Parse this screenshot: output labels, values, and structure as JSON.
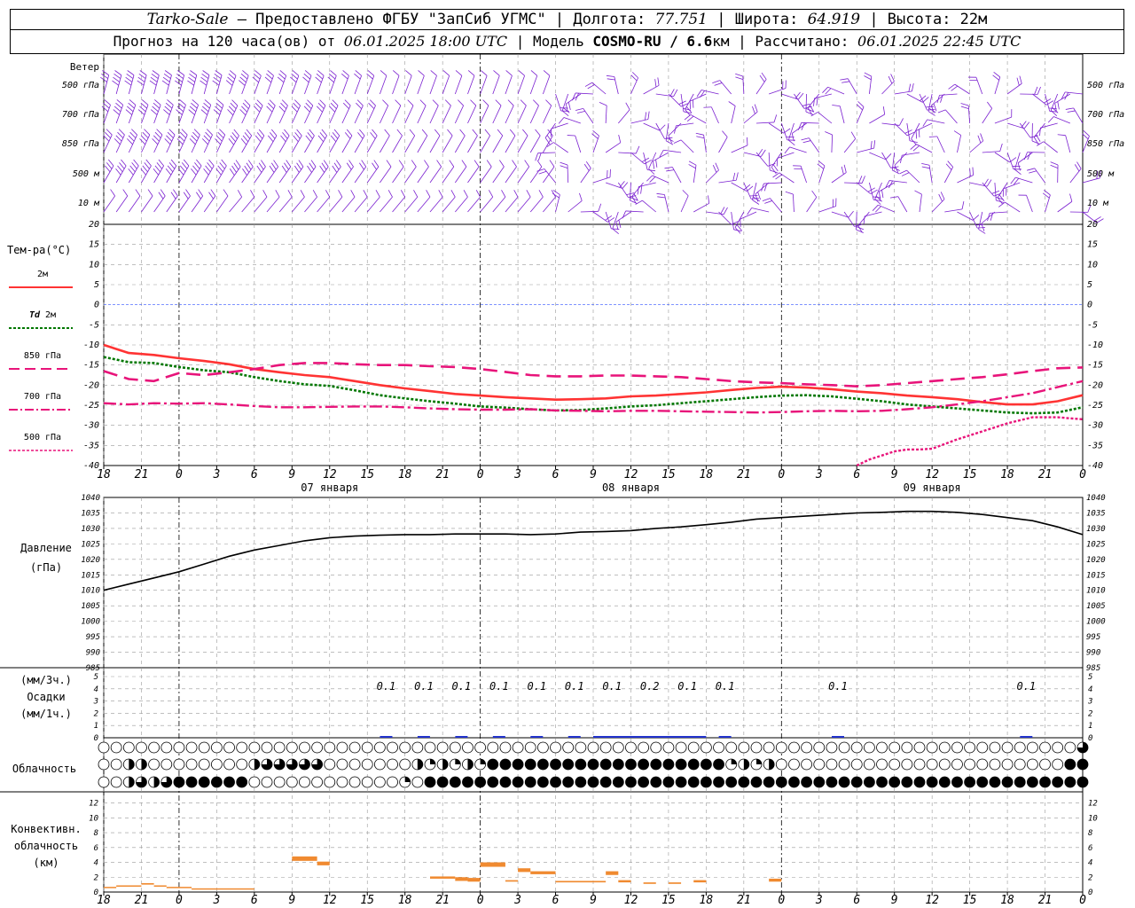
{
  "header": {
    "station": "Tarko-Sale",
    "provider": " – Предоставлено ФГБУ \"ЗапСиб УГМС\" | Долгота: ",
    "lon": "77.751",
    "lat_label": " | Широта: ",
    "lat": "64.919",
    "alt_label": " | Высота: 22м",
    "forecast_label": "Прогноз на 120 часа(ов) от ",
    "forecast_time": "06.01.2025 18:00 UTC",
    "model_label": " | Модель ",
    "model": "COSMO-RU / 6.6",
    "model_res_unit": "км",
    "calc_label": " | Рассчитано: ",
    "calc_time": "06.01.2025 22:45 UTC"
  },
  "wind_panel": {
    "title": "Ветер",
    "levels": [
      "500 гПа",
      "700 гПа",
      "850 гПа",
      "500 м",
      "10  м"
    ]
  },
  "colors": {
    "t2m": "#ff3333",
    "td2m": "#007700",
    "t850": "#e8147a",
    "t700": "#e8147a",
    "t500": "#e8147a",
    "wind": "#7a1fd0",
    "zero_line": "#3355ff",
    "precip": "#2233cc",
    "convective": "#f08a30"
  },
  "time_axis": {
    "tick_labels": [
      "18",
      "21",
      "0",
      "3",
      "6",
      "9",
      "12",
      "15",
      "18",
      "21",
      "0",
      "3",
      "6",
      "9",
      "12",
      "15",
      "18",
      "21",
      "0",
      "3",
      "6",
      "9",
      "12",
      "15",
      "18",
      "21",
      "0"
    ],
    "day_labels": [
      "07 января",
      "08 января",
      "09 января"
    ]
  },
  "temp_panel": {
    "title": "Тем-ра(°С)",
    "legend": [
      {
        "label": "2м",
        "italic_prefix": ""
      },
      {
        "label": "2м",
        "italic_prefix": "Td"
      },
      {
        "label": "850 гПа",
        "italic_prefix": ""
      },
      {
        "label": "700 гПа",
        "italic_prefix": ""
      },
      {
        "label": "500 гПа",
        "italic_prefix": ""
      }
    ],
    "y_ticks": [
      "20",
      "15",
      "10",
      "5",
      "0",
      "-5",
      "-10",
      "-15",
      "-20",
      "-25",
      "-30",
      "-35",
      "-40"
    ]
  },
  "pressure_panel": {
    "title_line1": "Давление",
    "title_line2": "(гПа)",
    "y_ticks": [
      "1040",
      "1035",
      "1030",
      "1025",
      "1020",
      "1015",
      "1010",
      "1005",
      "1000",
      "995",
      "990",
      "985"
    ]
  },
  "precip_panel": {
    "title_line1": "(мм/3ч.)",
    "title_line2": "Осадки",
    "title_line3": "(мм/1ч.)",
    "y_ticks": [
      "5",
      "4",
      "3",
      "2",
      "1",
      "0"
    ],
    "amount_labels": [
      {
        "t": 24,
        "text": "0.1"
      },
      {
        "t": 27,
        "text": "0.1"
      },
      {
        "t": 30,
        "text": "0.1"
      },
      {
        "t": 33,
        "text": "0.1"
      },
      {
        "t": 36,
        "text": "0.1"
      },
      {
        "t": 39,
        "text": "0.1"
      },
      {
        "t": 42,
        "text": "0.1"
      },
      {
        "t": 45,
        "text": "0.2"
      },
      {
        "t": 48,
        "text": "0.1"
      },
      {
        "t": 51,
        "text": "0.1"
      },
      {
        "t": 60,
        "text": "0.1"
      },
      {
        "t": 75,
        "text": "0.1"
      }
    ]
  },
  "cloud_panel": {
    "title": "Облачность"
  },
  "conv_panel": {
    "title_line1": "Конвективн.",
    "title_line2": "облачность",
    "title_line3": "(км)",
    "y_ticks": [
      "12",
      "10",
      "8",
      "6",
      "4",
      "2",
      "0"
    ]
  },
  "chart_data": [
    {
      "type": "line",
      "title": "Тем-ра(°С)",
      "x_unit": "hours since 06.01.2025 18:00 UTC",
      "ylim": [
        -40,
        20
      ],
      "series": [
        {
          "name": "2м",
          "x": [
            0,
            2,
            4,
            6,
            8,
            10,
            12,
            14,
            16,
            18,
            20,
            22,
            24,
            26,
            28,
            30,
            32,
            34,
            36,
            38,
            40,
            42,
            44,
            46,
            48,
            50,
            52,
            54,
            56,
            58,
            60,
            62,
            64,
            66,
            68,
            70,
            72,
            74,
            76,
            78
          ],
          "values": [
            -10,
            -12,
            -12.5,
            -13.3,
            -14,
            -14.8,
            -16,
            -16.8,
            -17.5,
            -18,
            -19,
            -20,
            -20.8,
            -21.5,
            -22.2,
            -22.6,
            -23,
            -23.3,
            -23.6,
            -23.5,
            -23.3,
            -22.8,
            -22.6,
            -22.2,
            -21.8,
            -21.2,
            -20.7,
            -20.4,
            -20.6,
            -21,
            -21.6,
            -22,
            -22.6,
            -23,
            -23.5,
            -24.2,
            -24.8,
            -24.8,
            -24,
            -22.5
          ]
        },
        {
          "name": "Td 2м",
          "x": [
            0,
            2,
            4,
            6,
            8,
            10,
            12,
            14,
            16,
            18,
            20,
            22,
            24,
            26,
            28,
            30,
            32,
            34,
            36,
            38,
            40,
            42,
            44,
            46,
            48,
            50,
            52,
            54,
            56,
            58,
            60,
            62,
            64,
            66,
            68,
            70,
            72,
            74,
            76,
            78
          ],
          "values": [
            -13,
            -14.3,
            -14.5,
            -15.5,
            -16.3,
            -16.8,
            -18,
            -19,
            -19.8,
            -20.2,
            -21.3,
            -22.5,
            -23.3,
            -24,
            -24.6,
            -25.3,
            -25.6,
            -26,
            -26.3,
            -26.2,
            -25.8,
            -25.3,
            -25,
            -24.5,
            -24,
            -23.5,
            -23,
            -22.6,
            -22.5,
            -22.8,
            -23.4,
            -24,
            -24.8,
            -25.3,
            -25.8,
            -26.3,
            -26.8,
            -27,
            -26.8,
            -25.5
          ]
        },
        {
          "name": "850 гПа",
          "x": [
            0,
            2,
            4,
            6,
            8,
            10,
            12,
            14,
            16,
            18,
            20,
            22,
            24,
            26,
            28,
            30,
            32,
            34,
            36,
            38,
            40,
            42,
            44,
            46,
            48,
            50,
            52,
            54,
            56,
            58,
            60,
            62,
            64,
            66,
            68,
            70,
            72,
            74,
            76,
            78
          ],
          "values": [
            -16.5,
            -18.5,
            -19,
            -17,
            -17.5,
            -16.8,
            -16,
            -15,
            -14.5,
            -14.5,
            -14.8,
            -15,
            -15,
            -15.3,
            -15.5,
            -16,
            -16.7,
            -17.5,
            -17.8,
            -17.8,
            -17.6,
            -17.6,
            -17.8,
            -18,
            -18.5,
            -19,
            -19.3,
            -19.5,
            -19.8,
            -20,
            -20.3,
            -20,
            -19.5,
            -19,
            -18.5,
            -18,
            -17.3,
            -16.5,
            -15.8,
            -15.6
          ]
        },
        {
          "name": "700 гПа",
          "x": [
            0,
            2,
            4,
            6,
            8,
            10,
            12,
            14,
            16,
            18,
            20,
            22,
            24,
            26,
            28,
            30,
            32,
            34,
            36,
            38,
            40,
            42,
            44,
            46,
            48,
            50,
            52,
            54,
            56,
            58,
            60,
            62,
            64,
            66,
            68,
            70,
            72,
            74,
            76,
            78
          ],
          "values": [
            -24.5,
            -24.8,
            -24.5,
            -24.6,
            -24.5,
            -24.8,
            -25.2,
            -25.5,
            -25.5,
            -25.4,
            -25.3,
            -25.3,
            -25.5,
            -25.8,
            -26,
            -26.1,
            -26.1,
            -26,
            -26.3,
            -26.4,
            -26.5,
            -26.4,
            -26.4,
            -26.5,
            -26.6,
            -26.7,
            -26.8,
            -26.7,
            -26.5,
            -26.4,
            -26.5,
            -26.4,
            -26,
            -25.5,
            -24.8,
            -24,
            -23,
            -22,
            -20.5,
            -19
          ]
        },
        {
          "name": "500 гПа",
          "x": [
            60,
            61,
            62,
            63,
            64,
            65,
            66,
            68,
            70,
            72,
            74,
            76,
            78
          ],
          "values": [
            -40,
            -38.5,
            -37.5,
            -36.5,
            -36,
            -36,
            -35.8,
            -33.5,
            -31.5,
            -29.5,
            -28,
            -28,
            -28.5
          ]
        }
      ]
    },
    {
      "type": "line",
      "title": "Давление",
      "ylabel": "(гПа)",
      "ylim": [
        985,
        1040
      ],
      "series": [
        {
          "name": "Давление",
          "x": [
            0,
            2,
            4,
            6,
            8,
            10,
            12,
            14,
            16,
            18,
            20,
            22,
            24,
            26,
            28,
            30,
            32,
            34,
            36,
            38,
            40,
            42,
            44,
            46,
            48,
            50,
            52,
            54,
            56,
            58,
            60,
            62,
            64,
            66,
            68,
            70,
            72,
            74,
            76,
            78
          ],
          "values": [
            1010,
            1012,
            1014,
            1016,
            1018.5,
            1021,
            1023,
            1024.5,
            1026,
            1027,
            1027.5,
            1027.8,
            1028,
            1028,
            1028.2,
            1028.2,
            1028.2,
            1028,
            1028.2,
            1028.8,
            1029,
            1029.3,
            1030,
            1030.5,
            1031.2,
            1032,
            1033,
            1033.5,
            1034,
            1034.5,
            1035,
            1035.2,
            1035.5,
            1035.5,
            1035.2,
            1034.5,
            1033.5,
            1032.5,
            1030.5,
            1028
          ]
        }
      ]
    },
    {
      "type": "bar",
      "title": "Конвективн. облачность (км)",
      "ylim": [
        0,
        13
      ],
      "segments": [
        {
          "x0": 0,
          "x1": 1,
          "bottom": 0.6,
          "top": 0.7
        },
        {
          "x0": 1,
          "x1": 3,
          "bottom": 0.8,
          "top": 0.9
        },
        {
          "x0": 3,
          "x1": 4,
          "bottom": 1.0,
          "top": 1.2
        },
        {
          "x0": 4,
          "x1": 5,
          "bottom": 0.8,
          "top": 0.9
        },
        {
          "x0": 5,
          "x1": 7,
          "bottom": 0.6,
          "top": 0.7
        },
        {
          "x0": 7,
          "x1": 12,
          "bottom": 0.4,
          "top": 0.5
        },
        {
          "x0": 15,
          "x1": 17,
          "bottom": 4.2,
          "top": 4.8
        },
        {
          "x0": 17,
          "x1": 18,
          "bottom": 3.6,
          "top": 4.1
        },
        {
          "x0": 26,
          "x1": 28,
          "bottom": 1.8,
          "top": 2.1
        },
        {
          "x0": 28,
          "x1": 29,
          "bottom": 1.5,
          "top": 2.0
        },
        {
          "x0": 29,
          "x1": 30,
          "bottom": 1.4,
          "top": 1.9
        },
        {
          "x0": 30,
          "x1": 32,
          "bottom": 3.4,
          "top": 4.0
        },
        {
          "x0": 32,
          "x1": 33,
          "bottom": 1.4,
          "top": 1.6
        },
        {
          "x0": 33,
          "x1": 34,
          "bottom": 2.7,
          "top": 3.2
        },
        {
          "x0": 34,
          "x1": 36,
          "bottom": 2.4,
          "top": 2.8
        },
        {
          "x0": 36,
          "x1": 40,
          "bottom": 1.3,
          "top": 1.5
        },
        {
          "x0": 40,
          "x1": 41,
          "bottom": 2.3,
          "top": 2.8
        },
        {
          "x0": 41,
          "x1": 42,
          "bottom": 1.3,
          "top": 1.6
        },
        {
          "x0": 43,
          "x1": 44,
          "bottom": 1.1,
          "top": 1.3
        },
        {
          "x0": 45,
          "x1": 46,
          "bottom": 1.1,
          "top": 1.3
        },
        {
          "x0": 47,
          "x1": 48,
          "bottom": 1.3,
          "top": 1.6
        },
        {
          "x0": 53,
          "x1": 54,
          "bottom": 1.4,
          "top": 1.8
        }
      ]
    }
  ]
}
